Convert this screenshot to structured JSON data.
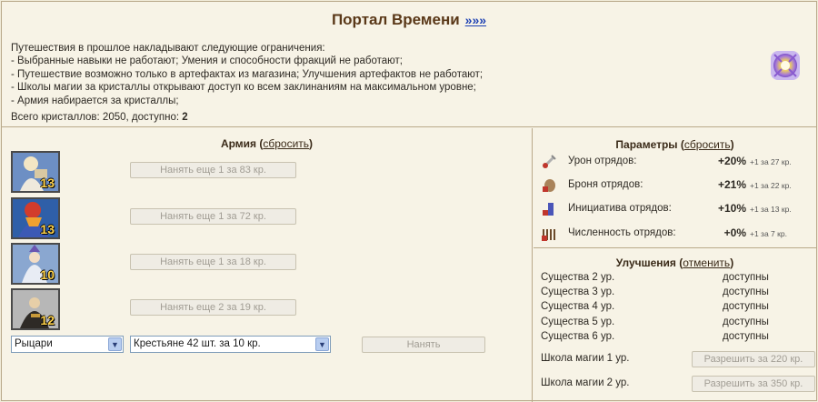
{
  "header": {
    "title": "Портал Времени",
    "link": "»»»"
  },
  "intro": {
    "lines": [
      "Путешествия в прошлое накладывают следующие ограничения:",
      "- Выбранные навыки не работают; Умения и способности фракций не работают;",
      "- Путешествие возможно только в артефактах из магазина; Улучшения артефактов не работают;",
      "- Школы магии за кристаллы открывают доступ ко всем заклинаниям на максимальном уровне;",
      "- Армия набирается за кристаллы;"
    ],
    "crystals_label": "Всего кристаллов: 2050, доступно:",
    "crystals_available": "2"
  },
  "army": {
    "title": "Армия",
    "reset_link": "сбросить",
    "units": [
      {
        "count": "13",
        "hire_label": "Нанять еще 1 за 83 кр.",
        "color": "#5a7fb8"
      },
      {
        "count": "13",
        "hire_label": "Нанять еще 1 за 72 кр.",
        "color": "#2f5fa8"
      },
      {
        "count": "10",
        "hire_label": "Нанять еще 1 за 18 кр.",
        "color": "#8aa7d0"
      },
      {
        "count": "12",
        "hire_label": "Нанять еще 2 за 19 кр.",
        "color": "#b0b0b0"
      }
    ],
    "faction_select": "Рыцари",
    "unit_select": "Крестьяне 42 шт. за 10 кр.",
    "hire_button": "Нанять"
  },
  "params": {
    "title": "Параметры",
    "reset_link": "сбросить",
    "rows": [
      {
        "name": "Урон отрядов:",
        "value": "+20%",
        "rate": "+1 за 27 кр.",
        "icon": "damage-icon"
      },
      {
        "name": "Броня отрядов:",
        "value": "+21%",
        "rate": "+1 за 22 кр.",
        "icon": "armor-icon"
      },
      {
        "name": "Инициатива отрядов:",
        "value": "+10%",
        "rate": "+1 за 13 кр.",
        "icon": "initiative-icon"
      },
      {
        "name": "Численность отрядов:",
        "value": "+0%",
        "rate": "+1 за 7 кр.",
        "icon": "troop-count-icon"
      }
    ]
  },
  "upgrades": {
    "title": "Улучшения",
    "cancel_link": "отменить",
    "rows": [
      {
        "name": "Существа 2 ур.",
        "status": "доступны"
      },
      {
        "name": "Существа 3 ур.",
        "status": "доступны"
      },
      {
        "name": "Существа 4 ур.",
        "status": "доступны"
      },
      {
        "name": "Существа 5 ур.",
        "status": "доступны"
      },
      {
        "name": "Существа 6 ур.",
        "status": "доступны"
      }
    ],
    "magic": [
      {
        "name": "Школа магии 1 ур.",
        "button": "Разрешить за 220 кр."
      },
      {
        "name": "Школа магии 2 ур.",
        "button": "Разрешить за 350 кр."
      }
    ]
  }
}
